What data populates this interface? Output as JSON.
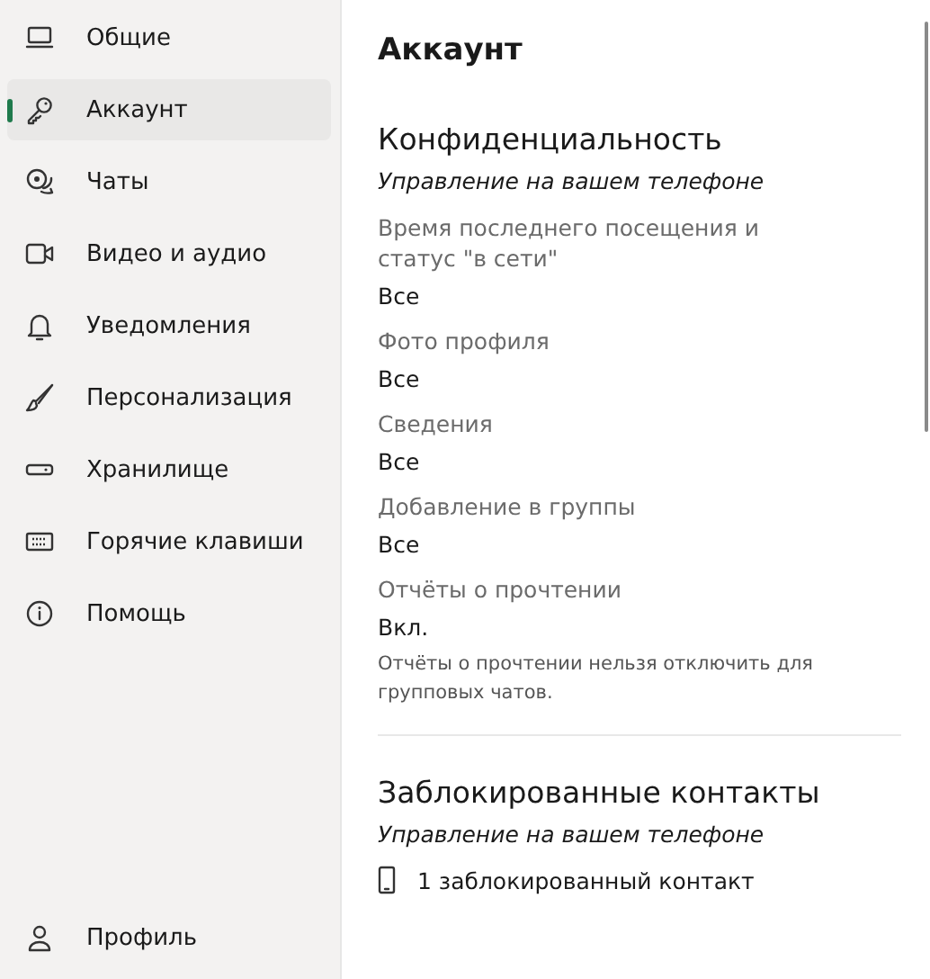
{
  "sidebar": {
    "items": [
      {
        "label": "Общие",
        "selected": false
      },
      {
        "label": "Аккаунт",
        "selected": true
      },
      {
        "label": "Чаты",
        "selected": false
      },
      {
        "label": "Видео и аудио",
        "selected": false
      },
      {
        "label": "Уведомления",
        "selected": false
      },
      {
        "label": "Персонализация",
        "selected": false
      },
      {
        "label": "Хранилище",
        "selected": false
      },
      {
        "label": "Горячие клавиши",
        "selected": false
      },
      {
        "label": "Помощь",
        "selected": false
      }
    ],
    "footer": {
      "label": "Профиль",
      "selected": false
    }
  },
  "content": {
    "title": "Аккаунт",
    "sections": [
      {
        "heading": "Конфиденциальность",
        "subtitle": "Управление на вашем телефоне",
        "settings": [
          {
            "label": "Время последнего посещения и статус \"в сети\"",
            "value": "Все"
          },
          {
            "label": "Фото профиля",
            "value": "Все"
          },
          {
            "label": "Сведения",
            "value": "Все"
          },
          {
            "label": "Добавление в группы",
            "value": "Все"
          },
          {
            "label": "Отчёты о прочтении",
            "value": "Вкл.",
            "note": "Отчёты о прочтении нельзя отключить для групповых чатов."
          }
        ]
      },
      {
        "heading": "Заблокированные контакты",
        "subtitle": "Управление на вашем телефоне",
        "items": [
          {
            "label": "1 заблокированный контакт"
          }
        ]
      }
    ]
  }
}
